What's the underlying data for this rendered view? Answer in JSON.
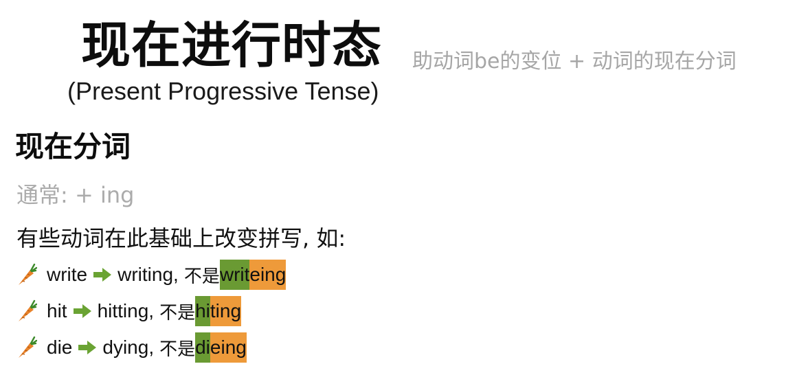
{
  "title": "现在进行时态",
  "subtitle": "(Present Progressive Tense)",
  "formula": "助动词be的变位 + 动词的现在分词",
  "section": {
    "heading": "现在分词",
    "usual_rule": "通常: + ing",
    "intro": "有些动词在此基础上改变拼写, 如:"
  },
  "examples": [
    {
      "verb": "write",
      "correct": "writing,",
      "not_label": "不是",
      "wrong_green": "writ",
      "wrong_orange": "eing"
    },
    {
      "verb": "hit",
      "correct": "hitting,",
      "not_label": "不是",
      "wrong_green": "hi",
      "wrong_orange": "ting"
    },
    {
      "verb": "die",
      "correct": "dying,",
      "not_label": "不是",
      "wrong_green": "di",
      "wrong_orange": "eing"
    }
  ],
  "icons": {
    "bullet": "carrot-icon",
    "arrow": "right-arrow-icon"
  },
  "colors": {
    "highlight_green": "#6a9a33",
    "highlight_orange": "#ee9a3a",
    "arrow_green": "#6aa333",
    "muted_text": "#a6a6a6"
  }
}
